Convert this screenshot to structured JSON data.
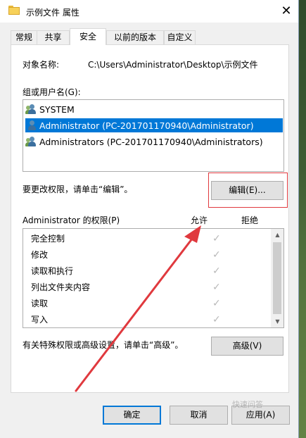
{
  "window": {
    "title": "示例文件 属性",
    "close_glyph": "✕"
  },
  "tabs": [
    {
      "label": "常规",
      "active": false
    },
    {
      "label": "共享",
      "active": false
    },
    {
      "label": "安全",
      "active": true
    },
    {
      "label": "以前的版本",
      "active": false
    },
    {
      "label": "自定义",
      "active": false
    }
  ],
  "security": {
    "object_name_label": "对象名称:",
    "object_name_value": "C:\\Users\\Administrator\\Desktop\\示例文件",
    "groups_label": "组或用户名(G):",
    "users": [
      {
        "name": "SYSTEM",
        "icon": "group-user-icon",
        "selected": false
      },
      {
        "name": "Administrator (PC-201701170940\\Administrator)",
        "icon": "user-icon",
        "selected": true
      },
      {
        "name": "Administrators (PC-201701170940\\Administrators)",
        "icon": "group-user-icon",
        "selected": false
      }
    ],
    "change_hint": "要更改权限，请单击“编辑”。",
    "edit_button": "编辑(E)...",
    "permissions_label": "Administrator 的权限(P)",
    "allow_header": "允许",
    "deny_header": "拒绝",
    "permissions": [
      {
        "name": "完全控制",
        "allow": true,
        "deny": false
      },
      {
        "name": "修改",
        "allow": true,
        "deny": false
      },
      {
        "name": "读取和执行",
        "allow": true,
        "deny": false
      },
      {
        "name": "列出文件夹内容",
        "allow": true,
        "deny": false
      },
      {
        "name": "读取",
        "allow": true,
        "deny": false
      },
      {
        "name": "写入",
        "allow": true,
        "deny": false
      }
    ],
    "advanced_hint": "有关特殊权限或高级设置，请单击“高级”。",
    "advanced_button": "高级(V)"
  },
  "footer": {
    "ok": "确定",
    "cancel": "取消",
    "apply": "应用(A)"
  },
  "annotation": {
    "highlight_color": "#e0393e",
    "arrow_color": "#e0393e"
  },
  "watermark": "快速问答"
}
